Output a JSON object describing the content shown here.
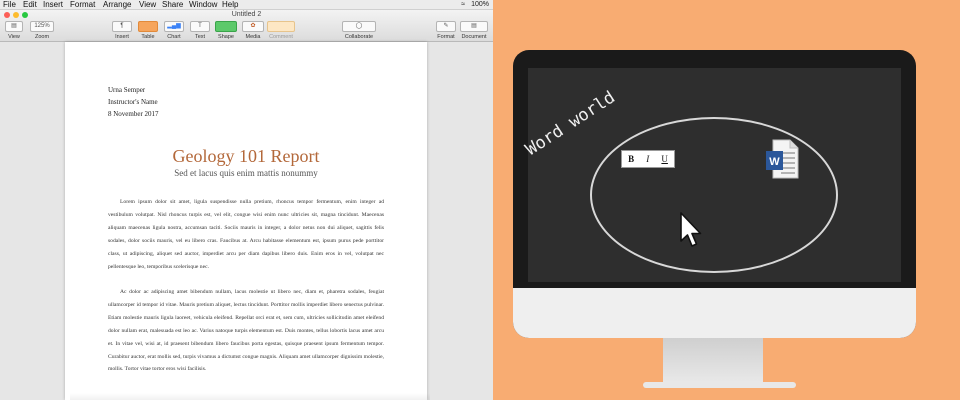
{
  "menubar": {
    "items": [
      "File",
      "Edit",
      "Insert",
      "Format",
      "Arrange",
      "View",
      "Share",
      "Window",
      "Help"
    ],
    "status": "100%"
  },
  "window": {
    "title": "Untitled 2"
  },
  "toolbar": {
    "view_value": "",
    "zoom_value": "125%",
    "view_label": "View",
    "zoom_label": "Zoom",
    "insert": "Insert",
    "table": "Table",
    "chart": "Chart",
    "text": "Text",
    "shape": "Shape",
    "media": "Media",
    "comment": "Comment",
    "collaborate": "Collaborate",
    "format": "Format",
    "document": "Document"
  },
  "document": {
    "author": "Urna Semper",
    "instructor": "Instructor's Name",
    "date": "8 November 2017",
    "title": "Geology 101 Report",
    "subtitle": "Sed et lacus quis enim mattis nonummy",
    "paragraphs": [
      "Lorem ipsum dolor sit amet, ligula suspendisse nulla pretium, rhoncus tempor fermentum, enim integer ad vestibulum volutpat. Nisl rhoncus turpis est, vel elit, congue wisi enim nunc ultricies sit, magna tincidunt. Maecenas aliquam maecenas ligula nostra, accumsan taciti. Sociis mauris in integer, a dolor netus non dui aliquet, sagittis felis sodales, dolor sociis mauris, vel eu libero cras. Faucibus at. Arcu habitasse elementum est, ipsum purus pede porttitor class, ut adipiscing, aliquet sed auctor, imperdiet arcu per diam dapibus libero duis. Enim eros in vel, volutpat nec pellentesque leo, temporibus scelerisque nec.",
      "Ac dolor ac adipiscing amet bibendum nullam, lacus molestie ut libero nec, diam et, pharetra sodales, feugiat ullamcorper id tempor id vitae. Mauris pretium aliquet, lectus tincidunt. Porttitor mollis imperdiet libero senectus pulvinar. Etiam molestie mauris ligula laoreet, vehicula eleifend. Repellat orci erat et, sem cum, ultricies sollicitudin amet eleifend dolor nullam erat, malesuada est leo ac. Varius natoque turpis elementum est. Duis montes, tellus lobortis lacus amet arcu et. In vitae vel, wisi at, id praesent bibendum libero faucibus porta egestas, quisque praesent ipsum fermentum tempor. Curabitur auctor, erat mollis sed, turpis vivamus a dictumst congue magnis. Aliquam amet ullamcorper dignissim molestie, mollis. Tortor vitae tortor eros wisi facilisis."
    ]
  },
  "illustration": {
    "caption": "Word world",
    "bold": "B",
    "italic": "I",
    "underline": "U",
    "word_letter": "W"
  },
  "colors": {
    "background": "#f8ac72",
    "title": "#b3683a",
    "screen": "#2e2e2e",
    "word_blue": "#2b579a"
  }
}
